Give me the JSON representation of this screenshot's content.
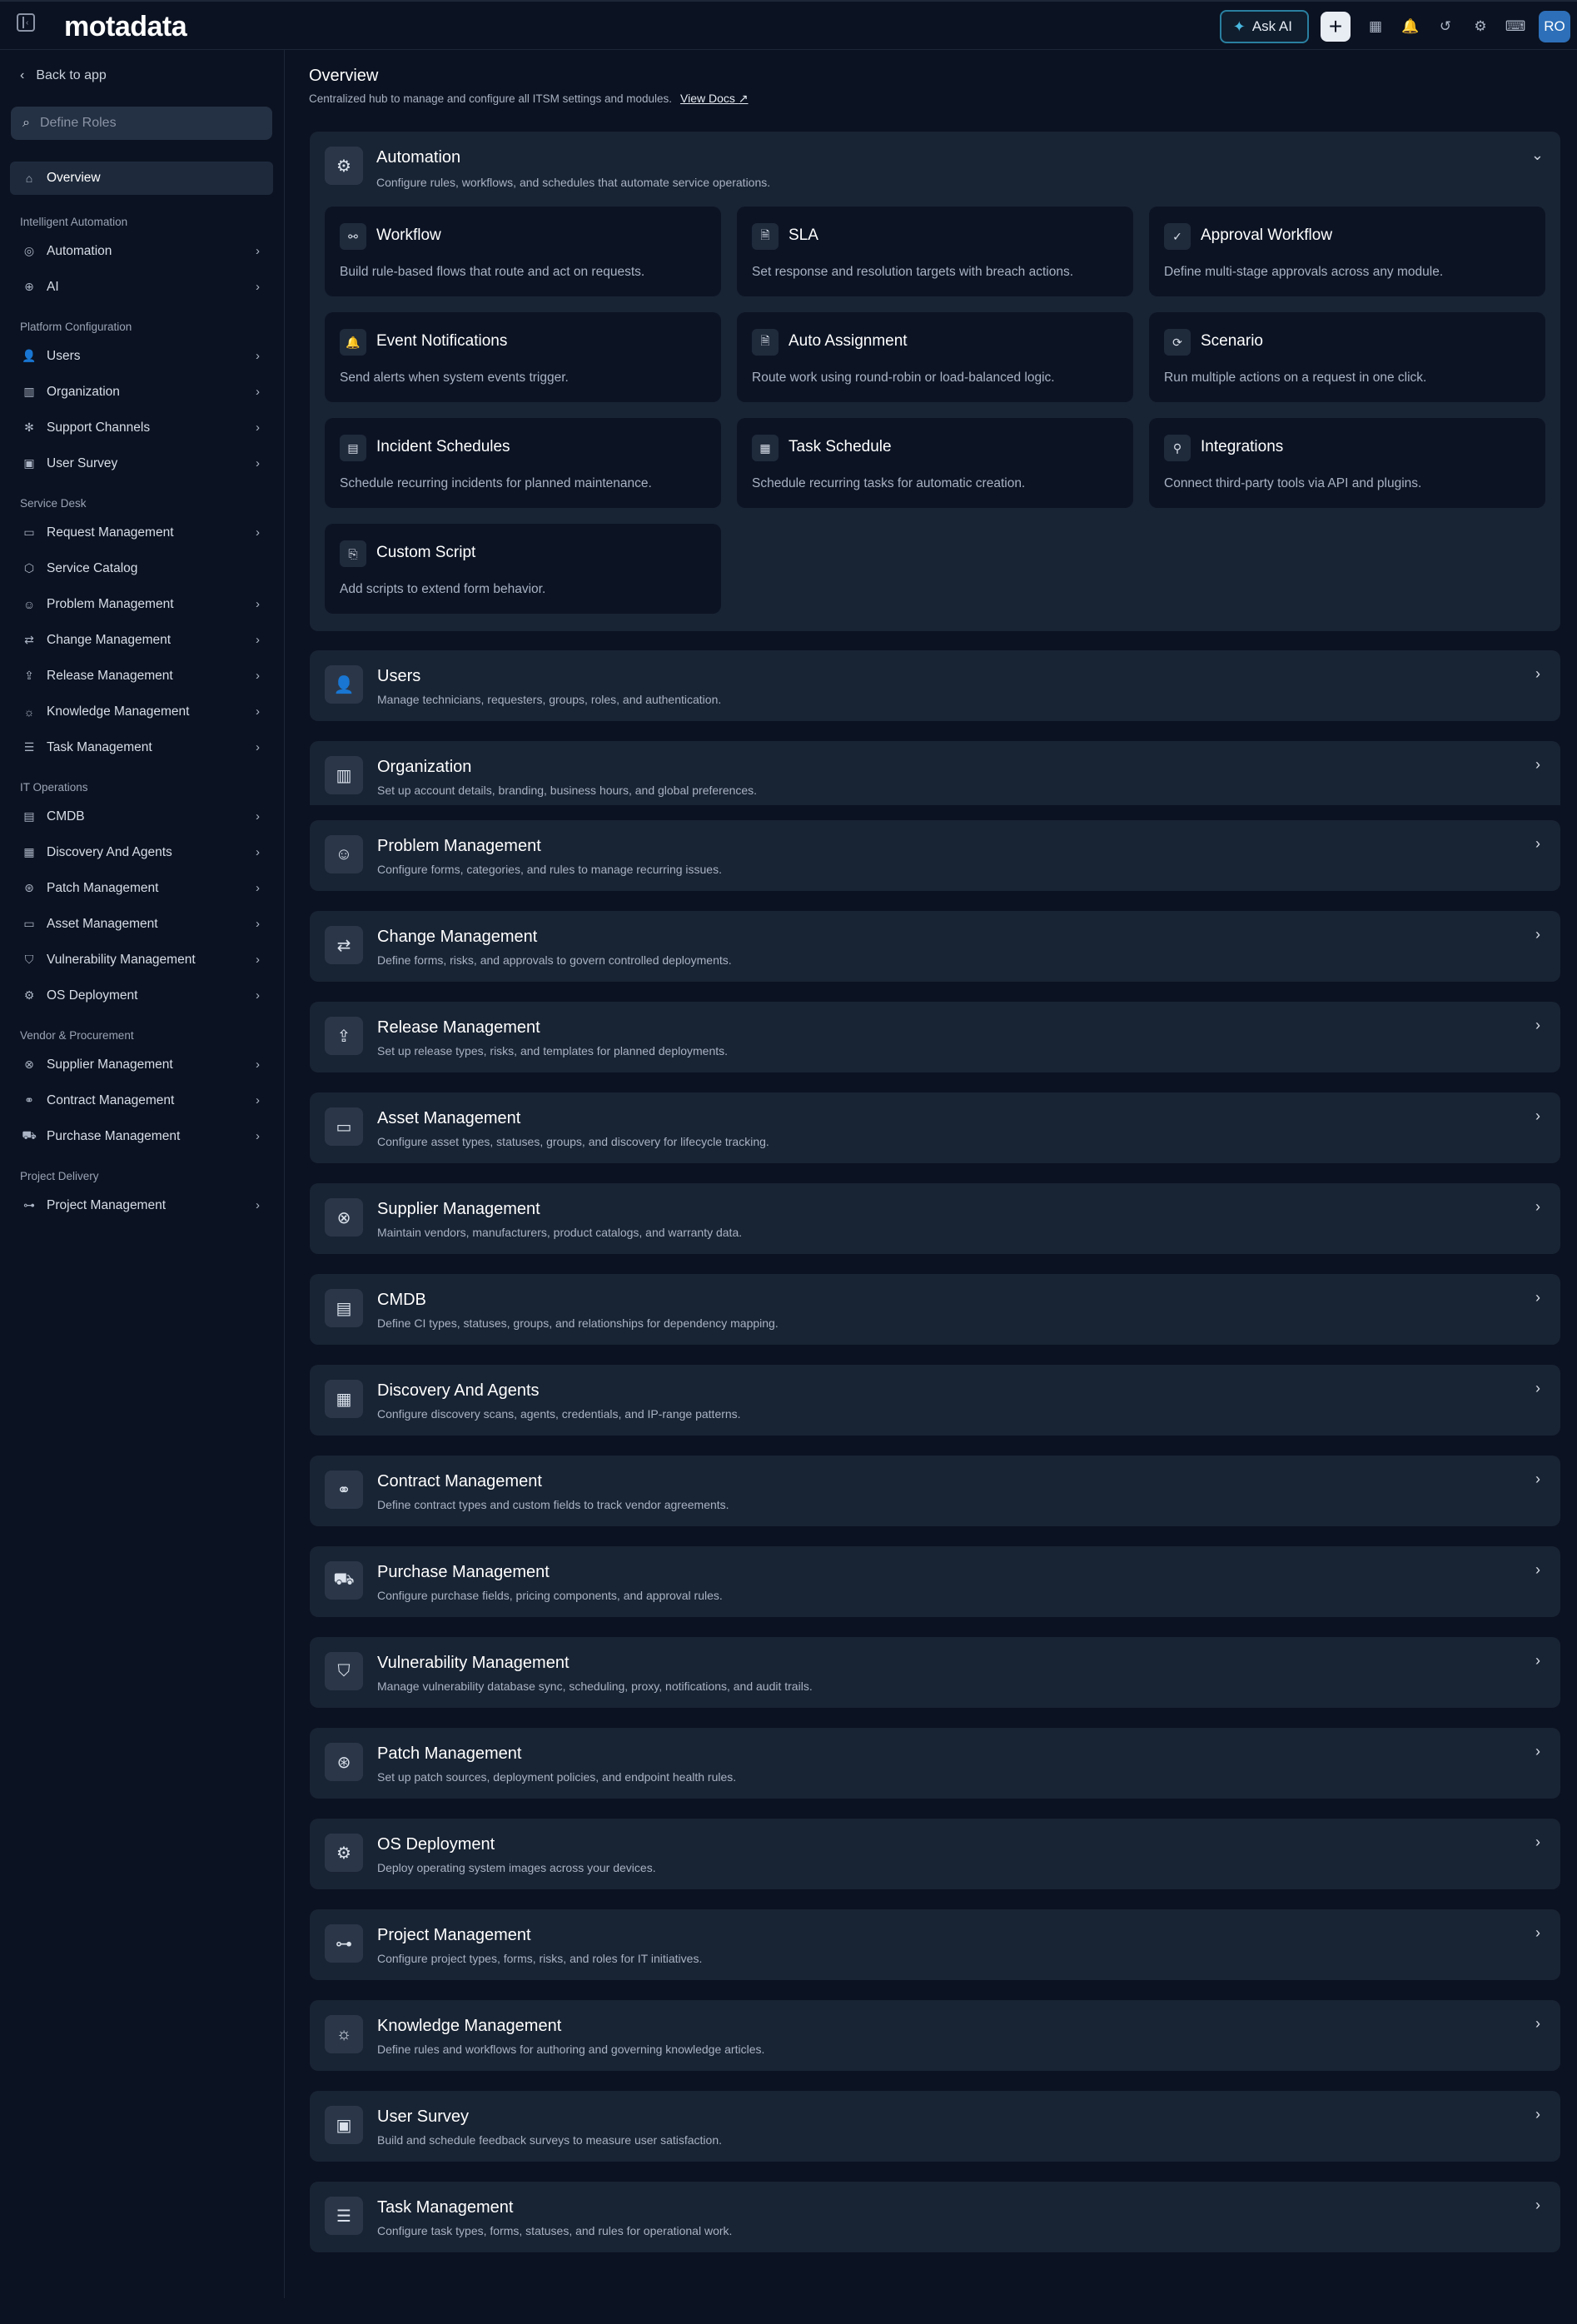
{
  "topbar": {
    "logo": "motadata",
    "ask_ai": "Ask AI",
    "avatar": "RO",
    "icons": [
      "calendar-icon",
      "bell-icon",
      "history-icon",
      "gear-icon",
      "keyboard-icon"
    ]
  },
  "sidebar": {
    "back": "Back to app",
    "search_placeholder": "Define Roles",
    "overview": "Overview",
    "sections": [
      {
        "title": "Intelligent Automation",
        "items": [
          {
            "label": "Automation",
            "icon": "◎",
            "chevron": true
          },
          {
            "label": "AI",
            "icon": "⊕",
            "chevron": true
          }
        ]
      },
      {
        "title": "Platform Configuration",
        "items": [
          {
            "label": "Users",
            "icon": "👤",
            "chevron": true
          },
          {
            "label": "Organization",
            "icon": "▥",
            "chevron": true
          },
          {
            "label": "Support Channels",
            "icon": "✻",
            "chevron": true
          },
          {
            "label": "User Survey",
            "icon": "▣",
            "chevron": true
          }
        ]
      },
      {
        "title": "Service Desk",
        "items": [
          {
            "label": "Request Management",
            "icon": "▭",
            "chevron": true
          },
          {
            "label": "Service Catalog",
            "icon": "⬡",
            "chevron": false
          },
          {
            "label": "Problem Management",
            "icon": "☺",
            "chevron": true
          },
          {
            "label": "Change Management",
            "icon": "⇄",
            "chevron": true
          },
          {
            "label": "Release Management",
            "icon": "⇪",
            "chevron": true
          },
          {
            "label": "Knowledge Management",
            "icon": "☼",
            "chevron": true
          },
          {
            "label": "Task Management",
            "icon": "☰",
            "chevron": true
          }
        ]
      },
      {
        "title": "IT Operations",
        "items": [
          {
            "label": "CMDB",
            "icon": "▤",
            "chevron": true
          },
          {
            "label": "Discovery And Agents",
            "icon": "▦",
            "chevron": true
          },
          {
            "label": "Patch Management",
            "icon": "⊛",
            "chevron": true
          },
          {
            "label": "Asset Management",
            "icon": "▭",
            "chevron": true
          },
          {
            "label": "Vulnerability Management",
            "icon": "⛉",
            "chevron": true
          },
          {
            "label": "OS Deployment",
            "icon": "⚙",
            "chevron": true
          }
        ]
      },
      {
        "title": "Vendor & Procurement",
        "items": [
          {
            "label": "Supplier Management",
            "icon": "⊗",
            "chevron": true
          },
          {
            "label": "Contract Management",
            "icon": "⚭",
            "chevron": true
          },
          {
            "label": "Purchase Management",
            "icon": "⛟",
            "chevron": true
          }
        ]
      },
      {
        "title": "Project Delivery",
        "items": [
          {
            "label": "Project Management",
            "icon": "⊶",
            "chevron": true
          }
        ]
      }
    ]
  },
  "main": {
    "title": "Overview",
    "subtitle": "Centralized hub to manage and configure all ITSM settings and modules.",
    "docs_link": "View Docs",
    "automation": {
      "title": "Automation",
      "description": "Configure rules, workflows, and schedules that automate service operations.",
      "cards": [
        {
          "title": "Workflow",
          "desc": "Build rule-based flows that route and act on requests.",
          "icon": "⚯"
        },
        {
          "title": "SLA",
          "desc": "Set response and resolution targets with breach actions.",
          "icon": "🗎"
        },
        {
          "title": "Approval Workflow",
          "desc": "Define multi-stage approvals across any module.",
          "icon": "✓"
        },
        {
          "title": "Event Notifications",
          "desc": "Send alerts when system events trigger.",
          "icon": "🔔"
        },
        {
          "title": "Auto Assignment",
          "desc": "Route work using round-robin or load-balanced logic.",
          "icon": "🗎"
        },
        {
          "title": "Scenario",
          "desc": "Run multiple actions on a request in one click.",
          "icon": "⟳"
        },
        {
          "title": "Incident Schedules",
          "desc": "Schedule recurring incidents for planned maintenance.",
          "icon": "▤"
        },
        {
          "title": "Task Schedule",
          "desc": "Schedule recurring tasks for automatic creation.",
          "icon": "▦"
        },
        {
          "title": "Integrations",
          "desc": "Connect third-party tools via API and plugins.",
          "icon": "⚲"
        },
        {
          "title": "Custom Script",
          "desc": "Add scripts to extend form behavior.",
          "icon": "⎘"
        }
      ]
    },
    "modules": [
      {
        "title": "Users",
        "desc": "Manage technicians, requesters, groups, roles, and authentication.",
        "icon": "👤"
      },
      {
        "title": "Organization",
        "desc": "Set up account details, branding, business hours, and global preferences.",
        "icon": "▥"
      },
      {
        "title": "Problem Management",
        "desc": "Configure forms, categories, and rules to manage recurring issues.",
        "icon": "☺"
      },
      {
        "title": "Change Management",
        "desc": "Define forms, risks, and approvals to govern controlled deployments.",
        "icon": "⇄"
      },
      {
        "title": "Release Management",
        "desc": "Set up release types, risks, and templates for planned deployments.",
        "icon": "⇪"
      },
      {
        "title": "Asset Management",
        "desc": "Configure asset types, statuses, groups, and discovery for lifecycle tracking.",
        "icon": "▭"
      },
      {
        "title": "Supplier Management",
        "desc": "Maintain vendors, manufacturers, product catalogs, and warranty data.",
        "icon": "⊗"
      },
      {
        "title": "CMDB",
        "desc": "Define CI types, statuses, groups, and relationships for dependency mapping.",
        "icon": "▤"
      },
      {
        "title": "Discovery And Agents",
        "desc": "Configure discovery scans, agents, credentials, and IP-range patterns.",
        "icon": "▦"
      },
      {
        "title": "Contract Management",
        "desc": "Define contract types and custom fields to track vendor agreements.",
        "icon": "⚭"
      },
      {
        "title": "Purchase Management",
        "desc": "Configure purchase fields, pricing components, and approval rules.",
        "icon": "⛟"
      },
      {
        "title": "Vulnerability Management",
        "desc": "Manage vulnerability database sync, scheduling, proxy, notifications, and audit trails.",
        "icon": "⛉"
      },
      {
        "title": "Patch Management",
        "desc": "Set up patch sources, deployment policies, and endpoint health rules.",
        "icon": "⊛"
      },
      {
        "title": "OS Deployment",
        "desc": "Deploy operating system images across your devices.",
        "icon": "⚙"
      },
      {
        "title": "Project Management",
        "desc": "Configure project types, forms, risks, and roles for IT initiatives.",
        "icon": "⊶"
      },
      {
        "title": "Knowledge Management",
        "desc": "Define rules and workflows for authoring and governing knowledge articles.",
        "icon": "☼"
      },
      {
        "title": "User Survey",
        "desc": "Build and schedule feedback surveys to measure user satisfaction.",
        "icon": "▣"
      },
      {
        "title": "Task Management",
        "desc": "Configure task types, forms, statuses, and rules for operational work.",
        "icon": "☰"
      }
    ]
  }
}
